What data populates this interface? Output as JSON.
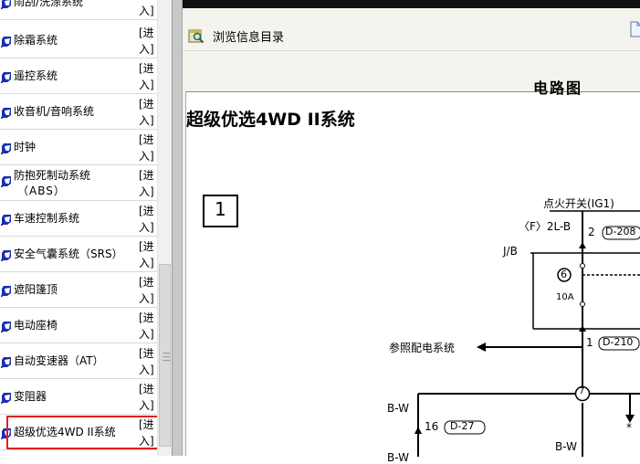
{
  "nav": {
    "items": [
      {
        "label": "雨刮/洗涤系统",
        "enter": "[进入]"
      },
      {
        "label": "除霜系统",
        "enter": "[进入]"
      },
      {
        "label": "遥控系统",
        "enter": "[进入]"
      },
      {
        "label": "收音机/音响系统",
        "enter": "[进入]"
      },
      {
        "label": "时钟",
        "enter": "[进入]"
      },
      {
        "label": "防抱死制动系统",
        "label2": "（ABS）",
        "enter": "[进入]"
      },
      {
        "label": "车速控制系统",
        "enter": "[进入]"
      },
      {
        "label": "安全气囊系统（SRS）",
        "enter": "[进入]"
      },
      {
        "label": "遮阳篷顶",
        "enter": "[进入]"
      },
      {
        "label": "电动座椅",
        "enter": "[进入]"
      },
      {
        "label": "自动变速器（AT）",
        "enter": "[进入]"
      },
      {
        "label": "变阻器",
        "enter": "[进入]"
      },
      {
        "label": "超级优选4WD II系统",
        "enter": "[进入]"
      }
    ]
  },
  "toolbar": {
    "browse_label": "浏览信息目录"
  },
  "document": {
    "header": "电路图",
    "title": "超级优选4WD II系统",
    "box_number": "1",
    "ignition_switch": "点火开关(IG1)",
    "wire_2lb": "〈F〉2L-B",
    "conn_2": "2",
    "ref_d208": "D-208",
    "jb_label": "J/B",
    "fuse_no": "6",
    "fuse_rating": "10A",
    "see_distribution": "参照配电系统",
    "conn_1": "1",
    "ref_d210": "D-210",
    "junction_7": "7",
    "bw_left": "B-W",
    "conn_16": "16",
    "ref_d27": "D-27",
    "bw_right": "B-W",
    "bw_bottom": "B-W",
    "star": "*"
  },
  "colors": {
    "highlight": "#e02020",
    "link_icon": "#1a2fb0"
  }
}
